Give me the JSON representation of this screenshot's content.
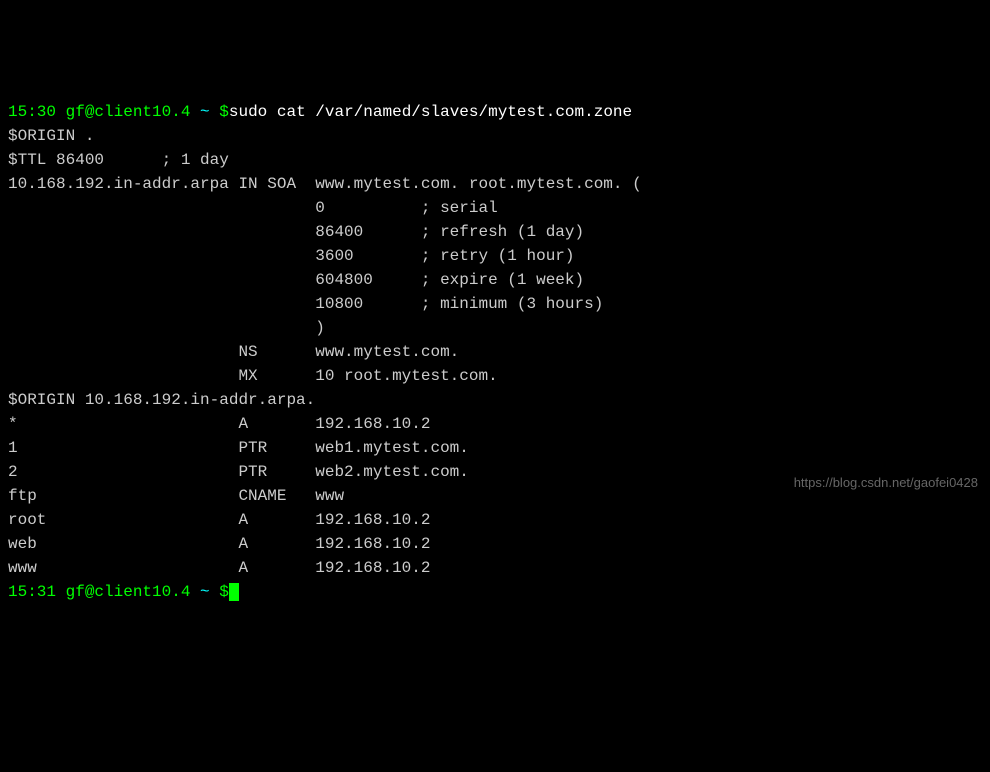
{
  "prompt1": {
    "time": "15:30",
    "userhost": " gf@client10.4 ",
    "path": "~ ",
    "dollar": "$",
    "command": "sudo cat /var/named/slaves/mytest.com.zone"
  },
  "lines": {
    "origin1": "$ORIGIN .",
    "ttl": "$TTL 86400      ; 1 day",
    "soa": "10.168.192.in-addr.arpa IN SOA  www.mytest.com. root.mytest.com. (",
    "serial": "                                0          ; serial",
    "refresh": "                                86400      ; refresh (1 day)",
    "retry": "                                3600       ; retry (1 hour)",
    "expire": "                                604800     ; expire (1 week)",
    "minimum": "                                10800      ; minimum (3 hours)",
    "close": "                                )",
    "ns": "                        NS      www.mytest.com.",
    "mx": "                        MX      10 root.mytest.com.",
    "origin2": "$ORIGIN 10.168.192.in-addr.arpa.",
    "rec1": "*                       A       192.168.10.2",
    "rec2": "1                       PTR     web1.mytest.com.",
    "rec3": "2                       PTR     web2.mytest.com.",
    "rec4": "ftp                     CNAME   www",
    "rec5": "root                    A       192.168.10.2",
    "rec6": "web                     A       192.168.10.2",
    "rec7": "www                     A       192.168.10.2"
  },
  "prompt2": {
    "time": "15:31",
    "userhost": " gf@client10.4 ",
    "path": "~ ",
    "dollar": "$"
  },
  "watermark": "https://blog.csdn.net/gaofei0428"
}
